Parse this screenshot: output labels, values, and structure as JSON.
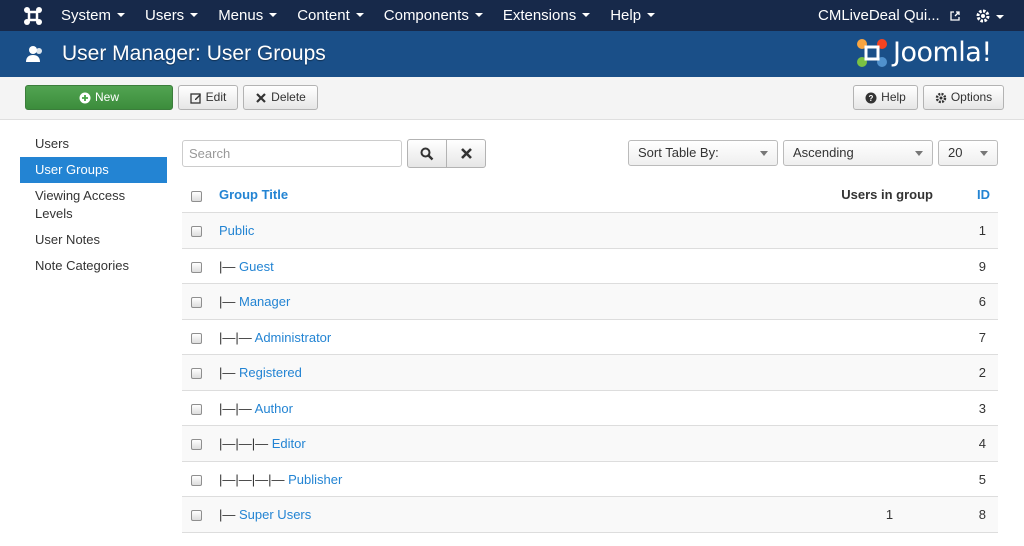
{
  "topbar": {
    "menu": [
      {
        "label": "System"
      },
      {
        "label": "Users"
      },
      {
        "label": "Menus"
      },
      {
        "label": "Content"
      },
      {
        "label": "Components"
      },
      {
        "label": "Extensions"
      },
      {
        "label": "Help"
      }
    ],
    "site_link": "CMLiveDeal Qui..."
  },
  "header": {
    "title": "User Manager: User Groups",
    "brand": "Joomla!"
  },
  "toolbar": {
    "new_label": "New",
    "edit_label": "Edit",
    "delete_label": "Delete",
    "help_label": "Help",
    "options_label": "Options"
  },
  "sidebar": {
    "items": [
      {
        "label": "Users"
      },
      {
        "label": "User Groups"
      },
      {
        "label": "Viewing Access Levels"
      },
      {
        "label": "User Notes"
      },
      {
        "label": "Note Categories"
      }
    ]
  },
  "filters": {
    "search_placeholder": "Search",
    "sort_by": "Sort Table By:",
    "direction": "Ascending",
    "limit": "20"
  },
  "table": {
    "headers": {
      "title": "Group Title",
      "users": "Users in group",
      "id": "ID"
    },
    "rows": [
      {
        "prefix": "",
        "title": "Public",
        "users": "",
        "id": "1"
      },
      {
        "prefix": "|— ",
        "title": "Guest",
        "users": "",
        "id": "9"
      },
      {
        "prefix": "|— ",
        "title": "Manager",
        "users": "",
        "id": "6"
      },
      {
        "prefix": "|—|— ",
        "title": "Administrator",
        "users": "",
        "id": "7"
      },
      {
        "prefix": "|— ",
        "title": "Registered",
        "users": "",
        "id": "2"
      },
      {
        "prefix": "|—|— ",
        "title": "Author",
        "users": "",
        "id": "3"
      },
      {
        "prefix": "|—|—|— ",
        "title": "Editor",
        "users": "",
        "id": "4"
      },
      {
        "prefix": "|—|—|—|— ",
        "title": "Publisher",
        "users": "",
        "id": "5"
      },
      {
        "prefix": "|— ",
        "title": "Super Users",
        "users": "1",
        "id": "8"
      }
    ]
  },
  "colors": {
    "topbar_bg": "#17294a",
    "header_bg": "#1a4f88",
    "new_button": "#46a546",
    "link": "#2384d3",
    "active_sidebar": "#2384d3"
  }
}
